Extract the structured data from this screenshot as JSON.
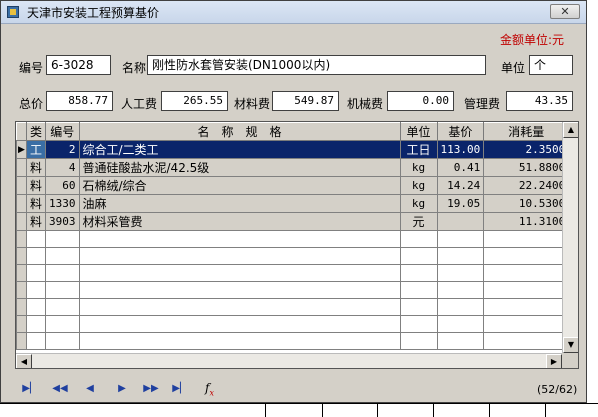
{
  "window": {
    "title": "天津市安装工程预算基价",
    "close_glyph": "✕"
  },
  "amount_unit": "金额单位:元",
  "header_fields": {
    "code_label": "编号",
    "code_value": "6-3028",
    "name_label": "名称",
    "name_value": "刚性防水套管安装(DN1000以内)",
    "unit_label": "单位",
    "unit_value": "个"
  },
  "price_fields": {
    "total_label": "总价",
    "total_value": "858.77",
    "labor_label": "人工费",
    "labor_value": "265.55",
    "material_label": "材料费",
    "material_value": "549.87",
    "machine_label": "机械费",
    "machine_value": "0.00",
    "mgmt_label": "管理费",
    "mgmt_value": "43.35"
  },
  "grid": {
    "columns": [
      "类",
      "编号",
      "名　称　规　格",
      "单位",
      "基价",
      "消耗量"
    ],
    "rows": [
      {
        "indicator": "▶",
        "type": "工",
        "code": "2",
        "name": "综合工/二类工",
        "unit": "工日",
        "price": "113.00",
        "qty": "2.3500"
      },
      {
        "indicator": "",
        "type": "料",
        "code": "4",
        "name": "普通硅酸盐水泥/42.5级",
        "unit": "kg",
        "price": "0.41",
        "qty": "51.8800"
      },
      {
        "indicator": "",
        "type": "料",
        "code": "60",
        "name": "石棉绒/综合",
        "unit": "kg",
        "price": "14.24",
        "qty": "22.2400"
      },
      {
        "indicator": "",
        "type": "料",
        "code": "1330",
        "name": "油麻",
        "unit": "kg",
        "price": "19.05",
        "qty": "10.5300"
      },
      {
        "indicator": "",
        "type": "料",
        "code": "3903",
        "name": "材料采管费",
        "unit": "元",
        "price": "",
        "qty": "11.3100"
      }
    ]
  },
  "navigator": {
    "first": "▶▏",
    "prev_page": "◀◀",
    "prev": "◀",
    "next": "▶",
    "next_page": "▶▶",
    "last": "▶▏",
    "fx": "f",
    "fx_sub": "x"
  },
  "page_indicator": "(52/62)"
}
